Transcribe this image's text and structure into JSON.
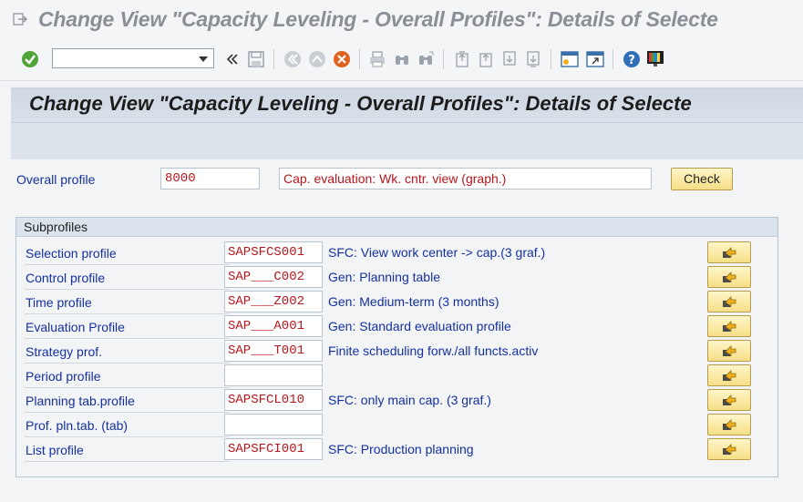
{
  "window": {
    "title": "Change View \"Capacity Leveling - Overall Profiles\": Details of Selecte"
  },
  "toolbar": {
    "command_value": "",
    "icons": [
      "enter-icon",
      "back-icon",
      "save-icon",
      "exit-icon",
      "up-icon",
      "cancel-icon",
      "print-icon",
      "find-icon",
      "find-next-icon",
      "first-page-icon",
      "previous-page-icon",
      "next-page-icon",
      "last-page-icon",
      "new-session-icon",
      "shortcut-icon",
      "help-icon",
      "customize-icon"
    ]
  },
  "screen": {
    "title": "Change View \"Capacity Leveling - Overall Profiles\": Details of Selecte"
  },
  "overall": {
    "label": "Overall profile",
    "value": "8000",
    "description": "Cap. evaluation: Wk. cntr. view (graph.)",
    "check_label": "Check"
  },
  "subprofiles": {
    "title": "Subprofiles",
    "rows": [
      {
        "label": "Selection profile",
        "value": "SAPSFCS001",
        "description": "SFC: View work center -> cap.(3 graf.)"
      },
      {
        "label": "Control profile",
        "value": "SAP___C002",
        "description": "Gen: Planning table"
      },
      {
        "label": "Time profile",
        "value": "SAP___Z002",
        "description": "Gen: Medium-term (3 months)"
      },
      {
        "label": "Evaluation Profile",
        "value": "SAP___A001",
        "description": "Gen: Standard evaluation profile"
      },
      {
        "label": "Strategy prof.",
        "value": "SAP___T001",
        "description": "Finite scheduling forw./all functs.activ"
      },
      {
        "label": "Period profile",
        "value": "",
        "description": ""
      },
      {
        "label": "Planning tab.profile",
        "value": "SAPSFCL010",
        "description": "SFC: only main cap. (3 graf.)"
      },
      {
        "label": "Prof. pln.tab. (tab)",
        "value": "",
        "description": ""
      },
      {
        "label": "List profile",
        "value": "SAPSFCI001",
        "description": "SFC: Production planning"
      }
    ]
  },
  "colors": {
    "label_blue": "#15309e",
    "value_red": "#b8161c",
    "button_yellow": "#f5df86"
  }
}
